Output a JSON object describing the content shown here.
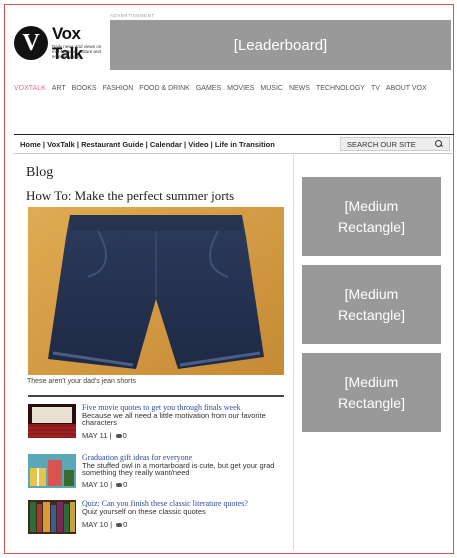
{
  "brand": {
    "logo_letter": "V",
    "name": "Vox Talk",
    "tagline": "Daily news and views on mid-Missouri culture and entertainment"
  },
  "ads": {
    "ad_label": "ADVERTISEMENT",
    "leaderboard": "[Leaderboard]",
    "medium_rectangles": [
      "[Medium Rectangle]",
      "[Medium Rectangle]",
      "[Medium Rectangle]"
    ]
  },
  "topnav": {
    "items": [
      "VOXTALK",
      "ART",
      "BOOKS",
      "FASHION",
      "FOOD & DRINK",
      "GAMES",
      "MOVIES",
      "MUSIC",
      "NEWS",
      "TECHNOLOGY",
      "TV",
      "ABOUT VOX"
    ],
    "active": "VOXTALK",
    "active_color": "#e36f8c"
  },
  "secnav": {
    "items": [
      "Home",
      "VoxTalk",
      "Restaurant Guide",
      "Calendar",
      "Video",
      "Life in Transition"
    ],
    "separator": " | ",
    "search_placeholder": "SEARCH OUR SITE"
  },
  "main": {
    "section_title": "Blog",
    "article_title": "How To: Make the perfect summer jorts",
    "caption": "These aren't your dad's jean shorts",
    "items": [
      {
        "title": "Five movie quotes to get you through finals week",
        "description": "Because we all need a little motivation from our favorite characters",
        "date": "MAY 11",
        "comments": "0",
        "thumb": "theater-thumbnail"
      },
      {
        "title": "Graduation gift ideas for everyone",
        "description": "The stuffed owl in a mortarboard is cute, but get your grad something they really want/need",
        "date": "MAY 10",
        "comments": "0",
        "thumb": "gifts-thumbnail"
      },
      {
        "title": "Quiz: Can you finish these classic literature quotes?",
        "description": "Quiz yourself on these classic quotes",
        "date": "MAY 10",
        "comments": "0",
        "thumb": "books-thumbnail"
      }
    ]
  },
  "colors": {
    "frame": "#d9534f",
    "link": "#2a4a9f",
    "ad_gray": "#999999"
  }
}
